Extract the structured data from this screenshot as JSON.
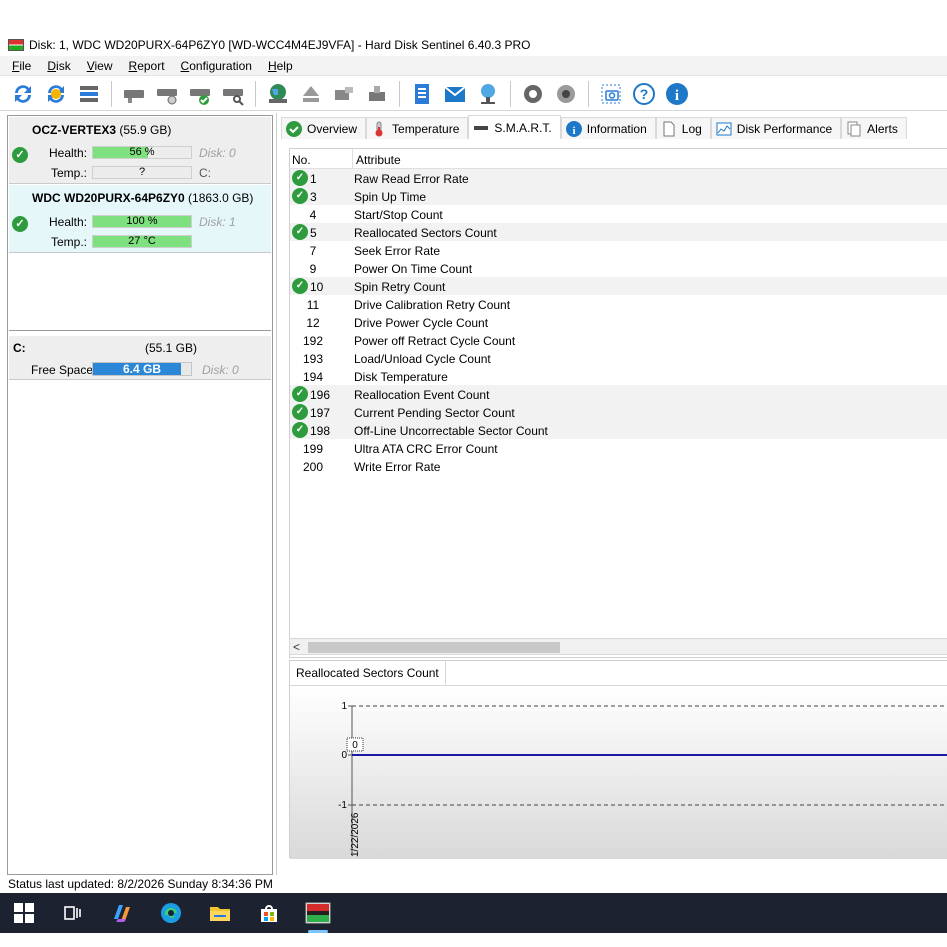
{
  "window": {
    "title": "Disk: 1, WDC WD20PURX-64P6ZY0 [WD-WCC4M4EJ9VFA]  -  Hard Disk Sentinel 6.40.3 PRO"
  },
  "menu": [
    "File",
    "Disk",
    "View",
    "Report",
    "Configuration",
    "Help"
  ],
  "toolbar": {
    "icons": [
      "refresh-icon",
      "refresh-all-icon",
      "disk-list-icon",
      "disk-icon",
      "disk-info-icon",
      "disk-test-icon",
      "disk-check-icon",
      "disk-search-icon",
      "globe-icon",
      "eject-icon",
      "disk-tool-icon",
      "disk-alt-icon",
      "report-icon",
      "email-icon",
      "network-icon",
      "settings-icon",
      "sound-icon",
      "screenshot-icon",
      "help-icon",
      "info-icon"
    ]
  },
  "disks": [
    {
      "name": "OCZ-VERTEX3",
      "size": "(55.9 GB)",
      "health_label": "Health:",
      "health": "56 %",
      "health_pct": 56,
      "disk_index": "Disk: 0",
      "temp_label": "Temp.:",
      "temp": "?",
      "drive_letter": "C:"
    },
    {
      "name": "WDC WD20PURX-64P6ZY0",
      "size": "(1863.0 GB)",
      "health_label": "Health:",
      "health": "100 %",
      "health_pct": 100,
      "disk_index": "Disk: 1",
      "temp_label": "Temp.:",
      "temp": "27 °C"
    }
  ],
  "volume": {
    "letter": "C:",
    "size": "(55.1 GB)",
    "free_label": "Free Space",
    "free": "6.4 GB",
    "free_pct": 90,
    "disk_index": "Disk: 0"
  },
  "tabs": [
    {
      "label": "Overview",
      "icon": "check-circle-icon"
    },
    {
      "label": "Temperature",
      "icon": "thermometer-icon"
    },
    {
      "label": "S.M.A.R.T.",
      "icon": "disk-icon",
      "active": true
    },
    {
      "label": "Information",
      "icon": "info-icon"
    },
    {
      "label": "Log",
      "icon": "document-icon"
    },
    {
      "label": "Disk Performance",
      "icon": "performance-chart-icon"
    },
    {
      "label": "Alerts",
      "icon": "alerts-icon"
    }
  ],
  "smart": {
    "col_no": "No.",
    "col_attr": "Attribute",
    "rows": [
      {
        "no": "1",
        "attr": "Raw Read Error Rate",
        "ok": true
      },
      {
        "no": "3",
        "attr": "Spin Up Time",
        "ok": true
      },
      {
        "no": "4",
        "attr": "Start/Stop Count",
        "ok": false
      },
      {
        "no": "5",
        "attr": "Reallocated Sectors Count",
        "ok": true
      },
      {
        "no": "7",
        "attr": "Seek Error Rate",
        "ok": false
      },
      {
        "no": "9",
        "attr": "Power On Time Count",
        "ok": false
      },
      {
        "no": "10",
        "attr": "Spin Retry Count",
        "ok": true
      },
      {
        "no": "11",
        "attr": "Drive Calibration Retry Count",
        "ok": false
      },
      {
        "no": "12",
        "attr": "Drive Power Cycle Count",
        "ok": false
      },
      {
        "no": "192",
        "attr": "Power off Retract Cycle Count",
        "ok": false
      },
      {
        "no": "193",
        "attr": "Load/Unload Cycle Count",
        "ok": false
      },
      {
        "no": "194",
        "attr": "Disk Temperature",
        "ok": false
      },
      {
        "no": "196",
        "attr": "Reallocation Event Count",
        "ok": true
      },
      {
        "no": "197",
        "attr": "Current Pending Sector Count",
        "ok": true
      },
      {
        "no": "198",
        "attr": "Off-Line Uncorrectable Sector Count",
        "ok": true
      },
      {
        "no": "199",
        "attr": "Ultra ATA CRC Error Count",
        "ok": false
      },
      {
        "no": "200",
        "attr": "Write Error Rate",
        "ok": false
      }
    ]
  },
  "chart_panel": {
    "tab_label": "Reallocated Sectors Count",
    "yticks": [
      "1",
      "0",
      "-1"
    ],
    "point_label": "0",
    "date_label": "1/22/2026",
    "series_color": "#1a1aa6"
  },
  "status": {
    "text": "Status last updated: 8/2/2026 Sunday 8:34:36 PM"
  },
  "taskbar": {
    "icons": [
      "windows-start-icon",
      "task-view-icon",
      "copilot-icon",
      "edge-icon",
      "file-explorer-icon",
      "store-icon",
      "hard-disk-sentinel-icon"
    ]
  }
}
